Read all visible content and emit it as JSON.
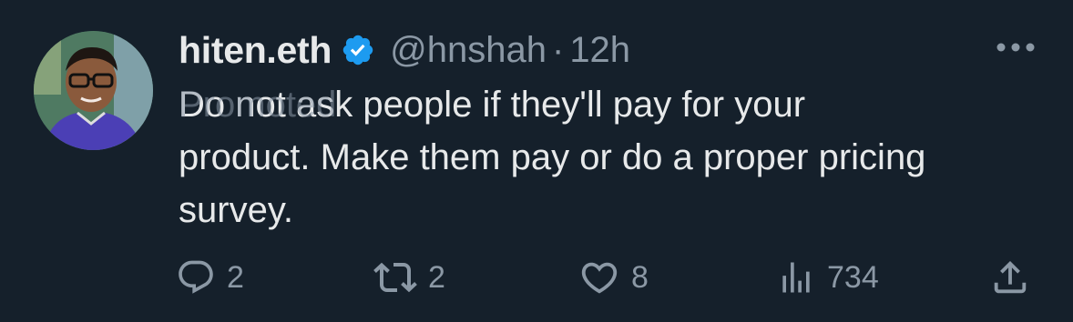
{
  "tweet": {
    "display_name": "hiten.eth",
    "verified_icon": "verified-badge-icon",
    "handle": "@hnshah",
    "separator": "·",
    "time": "12h",
    "promoted_label": "Promoted",
    "text_lines": [
      "Do not ask people if they'll pay for your",
      "product. Make them pay or do a proper pricing",
      "survey."
    ]
  },
  "actions": {
    "reply": {
      "icon": "reply-icon",
      "count": "2"
    },
    "retweet": {
      "icon": "retweet-icon",
      "count": "2"
    },
    "like": {
      "icon": "heart-icon",
      "count": "8"
    },
    "views": {
      "icon": "views-icon",
      "count": "734"
    },
    "share": {
      "icon": "share-icon"
    }
  },
  "colors": {
    "background": "#15202b",
    "text": "#e7e9ea",
    "secondary": "#8b98a5",
    "verified": "#1d9bf0"
  }
}
